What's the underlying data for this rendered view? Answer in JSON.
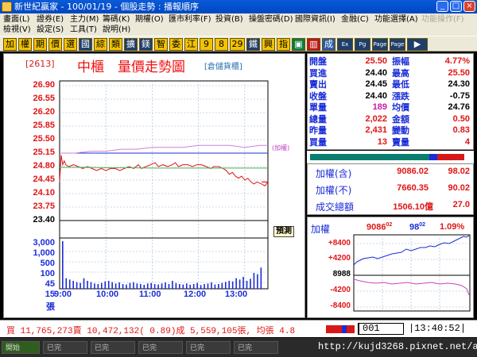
{
  "window": {
    "title": "新世紀贏家 - 100/01/19 - 個股走勢 : 播報順序",
    "buttons": [
      "_",
      "□",
      "×"
    ]
  },
  "menu": {
    "row1": [
      "畫面(L)",
      "證券(E)",
      "主力(M)",
      "籌碼(K)",
      "期權(O)",
      "匯市利率(F)",
      "投資(B)",
      "操盤密碼(D)",
      "國際資訊(I)",
      "金融(C)",
      "功能選擇(A)",
      "功能操作(F)"
    ],
    "row2": [
      "檢視(V)",
      "設定(S)",
      "工具(T)",
      "說明(H)"
    ]
  },
  "toolbar": {
    "buttons": [
      "加",
      "權",
      "期",
      "價",
      "選",
      "國",
      "綜",
      "類",
      "擴",
      "鎂",
      "智",
      "委",
      "江",
      "9",
      "8",
      "29",
      "鐵",
      "興",
      "指",
      "▣",
      "▥",
      "成",
      "Ex",
      "Pg",
      "Page",
      "Page",
      "▶"
    ]
  },
  "chart": {
    "code": "[2613]",
    "title": "中櫃　量價走勢圖",
    "type_label": "[倉儲貨櫃]",
    "price_labels": [
      "26.90",
      "26.55",
      "26.20",
      "25.85",
      "25.50",
      "25.15",
      "24.80",
      "24.45",
      "24.10",
      "23.75",
      "23.40"
    ],
    "volume_labels": [
      "3,000",
      "1,000",
      "500",
      "100",
      "45",
      "15",
      "張"
    ],
    "time_labels": [
      "9:00",
      "10:00",
      "11:00",
      "12:00",
      "13:00"
    ],
    "ref_label": "(加權)",
    "forecast_label": "預測"
  },
  "chart_data": {
    "type": "line",
    "title": "中櫃　量價走勢圖",
    "x_range": [
      "9:00",
      "13:30"
    ],
    "ylim": [
      23.4,
      26.9
    ],
    "series": [
      {
        "values": [
          [
            0,
            24.4
          ],
          [
            2,
            25.1
          ],
          [
            4,
            24.85
          ],
          [
            6,
            24.95
          ],
          [
            8,
            24.85
          ],
          [
            12,
            24.8
          ],
          [
            18,
            24.85
          ],
          [
            24,
            24.8
          ],
          [
            30,
            24.75
          ],
          [
            36,
            24.8
          ],
          [
            42,
            24.75
          ],
          [
            48,
            24.7
          ],
          [
            54,
            24.75
          ],
          [
            60,
            24.7
          ],
          [
            66,
            24.75
          ],
          [
            72,
            24.75
          ],
          [
            78,
            24.7
          ],
          [
            84,
            24.75
          ],
          [
            90,
            24.8
          ],
          [
            96,
            24.75
          ],
          [
            102,
            24.85
          ],
          [
            106,
            24.75
          ],
          [
            112,
            24.8
          ],
          [
            118,
            24.85
          ],
          [
            124,
            24.9
          ],
          [
            128,
            24.8
          ],
          [
            134,
            24.85
          ],
          [
            140,
            24.8
          ],
          [
            146,
            24.85
          ],
          [
            150,
            24.9
          ],
          [
            154,
            24.8
          ],
          [
            160,
            24.85
          ],
          [
            166,
            24.85
          ],
          [
            172,
            24.8
          ],
          [
            178,
            24.85
          ],
          [
            184,
            24.85
          ],
          [
            190,
            24.8
          ],
          [
            196,
            24.75
          ],
          [
            200,
            24.8
          ],
          [
            206,
            24.8
          ],
          [
            212,
            24.75
          ],
          [
            216,
            24.7
          ],
          [
            220,
            24.6
          ],
          [
            224,
            24.65
          ],
          [
            228,
            24.55
          ],
          [
            232,
            24.5
          ],
          [
            236,
            24.55
          ],
          [
            240,
            24.45
          ],
          [
            244,
            24.5
          ],
          [
            248,
            24.4
          ],
          [
            252,
            24.35
          ],
          [
            256,
            24.4
          ],
          [
            262,
            24.35
          ],
          [
            266,
            24.3
          ],
          [
            270,
            24.4
          ]
        ]
      },
      {
        "values": [
          [
            0,
            25.15
          ],
          [
            20,
            25.15
          ],
          [
            40,
            25.2
          ],
          [
            60,
            25.2
          ],
          [
            80,
            25.25
          ],
          [
            100,
            25.25
          ],
          [
            120,
            25.3
          ],
          [
            140,
            25.3
          ],
          [
            160,
            25.3
          ],
          [
            180,
            25.35
          ],
          [
            200,
            25.35
          ],
          [
            220,
            25.35
          ],
          [
            240,
            25.3
          ],
          [
            260,
            25.35
          ],
          [
            270,
            25.35
          ]
        ]
      },
      {
        "values": [
          [
            0,
            24.78
          ],
          [
            30,
            24.78
          ],
          [
            60,
            24.77
          ],
          [
            90,
            24.77
          ],
          [
            120,
            24.76
          ],
          [
            150,
            24.76
          ],
          [
            180,
            24.76
          ],
          [
            210,
            24.76
          ],
          [
            240,
            24.76
          ],
          [
            270,
            24.76
          ]
        ]
      }
    ],
    "volume": [
      180,
      40,
      35,
      30,
      25,
      22,
      40,
      30,
      25,
      20,
      18,
      22,
      28,
      30,
      25,
      20,
      24,
      18,
      16,
      22,
      25,
      20,
      18,
      15,
      20,
      22,
      18,
      16,
      20,
      24,
      18,
      30,
      22,
      18,
      16,
      20,
      15,
      18,
      22,
      14,
      18,
      20,
      24,
      16,
      18,
      22,
      26,
      30,
      28,
      40,
      35,
      45,
      30,
      38,
      60,
      55,
      80
    ],
    "reference_price": 24.4,
    "xlabel": "",
    "ylabel": "",
    "grid": true
  },
  "quote": {
    "rows": [
      {
        "l1": "開盤",
        "v1": "25.50",
        "c1": "up",
        "l2": "振幅",
        "v2": "4.77%",
        "c2": "up"
      },
      {
        "l1": "買進",
        "v1": "24.40",
        "c1": "blk",
        "l2": "最高",
        "v2": "25.50",
        "c2": "up"
      },
      {
        "l1": "賣出",
        "v1": "24.45",
        "c1": "blk",
        "l2": "最低",
        "v2": "24.30",
        "c2": "blk"
      },
      {
        "l1": "收盤",
        "v1": "24.40",
        "c1": "blk",
        "l2": "漲跌",
        "v2": "-0.75",
        "c2": "blk"
      },
      {
        "l1": "單量",
        "v1": "189",
        "c1": "mgn",
        "l2": "均價",
        "v2": "24.76",
        "c2": "blk"
      },
      {
        "l1": "總量",
        "v1": "2,022",
        "c1": "up",
        "l2": "金額",
        "v2": "0.50",
        "c2": "up"
      },
      {
        "l1": "昨量",
        "v1": "2,431",
        "c1": "up",
        "l2": "變動",
        "v2": "0.83",
        "c2": "up"
      },
      {
        "l1": "買量",
        "v1": "13",
        "c1": "up",
        "l2": "賣量",
        "v2": "4",
        "c2": "up"
      }
    ]
  },
  "index": {
    "rows": [
      {
        "label": "加權(含)",
        "value": "9086.02",
        "change": "98.02"
      },
      {
        "label": "加權(不)",
        "value": "7660.35",
        "change": "90.02"
      },
      {
        "label": "成交總額",
        "value": "1506.10億",
        "change": "27.0"
      }
    ]
  },
  "mini": {
    "label": "加權",
    "value_main": "9086",
    "value_dec": "02",
    "change_main": "98",
    "change_dec": "02",
    "pct": "1.09%",
    "y_labels": [
      "+8400",
      "+4200",
      "8988",
      "-4200",
      "-8400"
    ]
  },
  "status": {
    "text": "買 11,765,273賣 10,472,132( 0.89)成 5,559,105張, 均張 4.8",
    "code": "001",
    "time": "13:40:52"
  },
  "taskbar": {
    "tasks": [
      "開始",
      "已完",
      "已完",
      "已完",
      "已完",
      "已完"
    ],
    "watermark": "http://kujd3268.pixnet.net/album"
  },
  "colors": {
    "price_line": "#e01515",
    "avg_line": "#4caf50",
    "index_line": "#d080d8",
    "volume_bar": "#1a2cd8",
    "accent": "#1a2cd8"
  }
}
